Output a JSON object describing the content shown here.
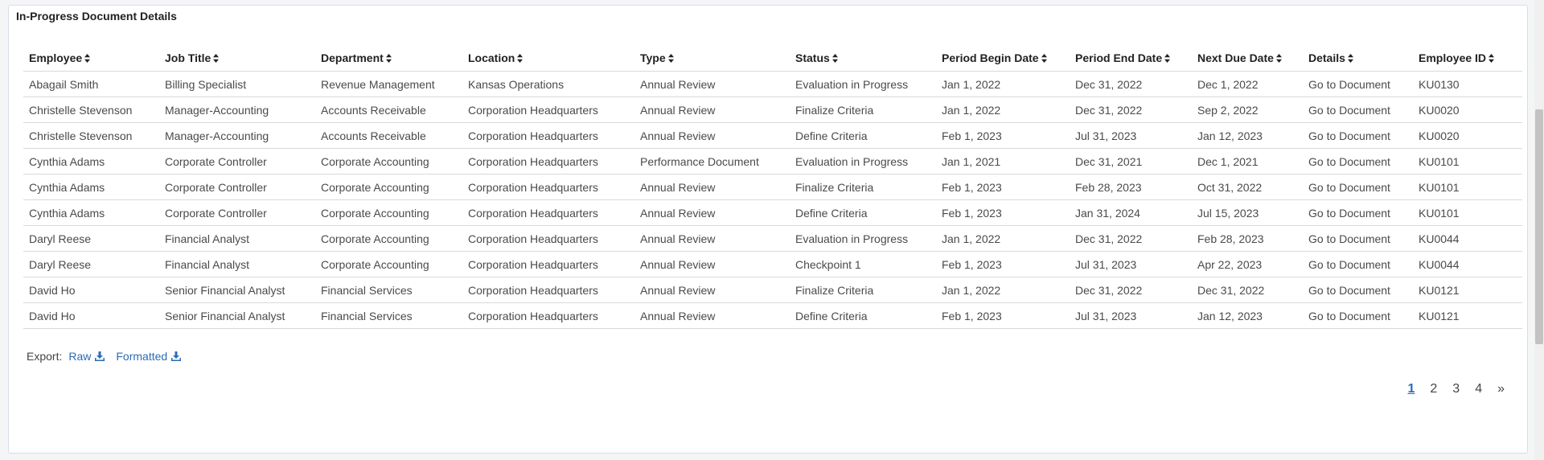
{
  "panel": {
    "title": "In-Progress Document Details"
  },
  "table": {
    "columns": [
      {
        "key": "employee",
        "label": "Employee"
      },
      {
        "key": "job_title",
        "label": "Job Title"
      },
      {
        "key": "department",
        "label": "Department"
      },
      {
        "key": "location",
        "label": "Location"
      },
      {
        "key": "type",
        "label": "Type"
      },
      {
        "key": "status",
        "label": "Status"
      },
      {
        "key": "period_begin",
        "label": "Period Begin Date"
      },
      {
        "key": "period_end",
        "label": "Period End Date"
      },
      {
        "key": "next_due",
        "label": "Next Due Date"
      },
      {
        "key": "details",
        "label": "Details"
      },
      {
        "key": "employee_id",
        "label": "Employee ID"
      }
    ],
    "rows": [
      {
        "employee": "Abagail Smith",
        "job_title": "Billing Specialist",
        "department": "Revenue Management",
        "location": "Kansas Operations",
        "type": "Annual Review",
        "status": "Evaluation in Progress",
        "period_begin": "Jan 1, 2022",
        "period_end": "Dec 31, 2022",
        "next_due": "Dec 1, 2022",
        "details": "Go to Document",
        "employee_id": "KU0130"
      },
      {
        "employee": "Christelle Stevenson",
        "job_title": "Manager-Accounting",
        "department": "Accounts Receivable",
        "location": "Corporation Headquarters",
        "type": "Annual Review",
        "status": "Finalize Criteria",
        "period_begin": "Jan 1, 2022",
        "period_end": "Dec 31, 2022",
        "next_due": "Sep 2, 2022",
        "details": "Go to Document",
        "employee_id": "KU0020"
      },
      {
        "employee": "Christelle Stevenson",
        "job_title": "Manager-Accounting",
        "department": "Accounts Receivable",
        "location": "Corporation Headquarters",
        "type": "Annual Review",
        "status": "Define Criteria",
        "period_begin": "Feb 1, 2023",
        "period_end": "Jul 31, 2023",
        "next_due": "Jan 12, 2023",
        "details": "Go to Document",
        "employee_id": "KU0020"
      },
      {
        "employee": "Cynthia Adams",
        "job_title": "Corporate Controller",
        "department": "Corporate Accounting",
        "location": "Corporation Headquarters",
        "type": "Performance Document",
        "status": "Evaluation in Progress",
        "period_begin": "Jan 1, 2021",
        "period_end": "Dec 31, 2021",
        "next_due": "Dec 1, 2021",
        "details": "Go to Document",
        "employee_id": "KU0101"
      },
      {
        "employee": "Cynthia Adams",
        "job_title": "Corporate Controller",
        "department": "Corporate Accounting",
        "location": "Corporation Headquarters",
        "type": "Annual Review",
        "status": "Finalize Criteria",
        "period_begin": "Feb 1, 2023",
        "period_end": "Feb 28, 2023",
        "next_due": "Oct 31, 2022",
        "details": "Go to Document",
        "employee_id": "KU0101"
      },
      {
        "employee": "Cynthia Adams",
        "job_title": "Corporate Controller",
        "department": "Corporate Accounting",
        "location": "Corporation Headquarters",
        "type": "Annual Review",
        "status": "Define Criteria",
        "period_begin": "Feb 1, 2023",
        "period_end": "Jan 31, 2024",
        "next_due": "Jul 15, 2023",
        "details": "Go to Document",
        "employee_id": "KU0101"
      },
      {
        "employee": "Daryl Reese",
        "job_title": "Financial Analyst",
        "department": "Corporate Accounting",
        "location": "Corporation Headquarters",
        "type": "Annual Review",
        "status": "Evaluation in Progress",
        "period_begin": "Jan 1, 2022",
        "period_end": "Dec 31, 2022",
        "next_due": "Feb 28, 2023",
        "details": "Go to Document",
        "employee_id": "KU0044"
      },
      {
        "employee": "Daryl Reese",
        "job_title": "Financial Analyst",
        "department": "Corporate Accounting",
        "location": "Corporation Headquarters",
        "type": "Annual Review",
        "status": "Checkpoint 1",
        "period_begin": "Feb 1, 2023",
        "period_end": "Jul 31, 2023",
        "next_due": "Apr 22, 2023",
        "details": "Go to Document",
        "employee_id": "KU0044"
      },
      {
        "employee": "David Ho",
        "job_title": "Senior Financial Analyst",
        "department": "Financial Services",
        "location": "Corporation Headquarters",
        "type": "Annual Review",
        "status": "Finalize Criteria",
        "period_begin": "Jan 1, 2022",
        "period_end": "Dec 31, 2022",
        "next_due": "Dec 31, 2022",
        "details": "Go to Document",
        "employee_id": "KU0121"
      },
      {
        "employee": "David Ho",
        "job_title": "Senior Financial Analyst",
        "department": "Financial Services",
        "location": "Corporation Headquarters",
        "type": "Annual Review",
        "status": "Define Criteria",
        "period_begin": "Feb 1, 2023",
        "period_end": "Jul 31, 2023",
        "next_due": "Jan 12, 2023",
        "details": "Go to Document",
        "employee_id": "KU0121"
      }
    ]
  },
  "export": {
    "label": "Export:",
    "raw_label": "Raw",
    "formatted_label": "Formatted",
    "icon": "download-icon"
  },
  "pagination": {
    "pages": [
      "1",
      "2",
      "3",
      "4"
    ],
    "current": "1",
    "next_label": "»"
  },
  "colors": {
    "link": "#2a6cb6",
    "border": "#d6d9de",
    "header_text": "#222222",
    "cell_text": "#4a4a4a"
  }
}
